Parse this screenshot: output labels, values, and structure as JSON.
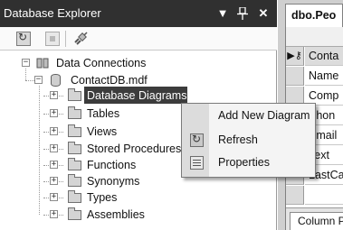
{
  "explorer": {
    "title": "Database Explorer",
    "dropdown_glyph": "▼",
    "pin_glyph": "⨃",
    "close_glyph": "✕"
  },
  "tree": {
    "root": "Data Connections",
    "database": "ContactDB.mdf",
    "children": [
      "Database Diagrams",
      "Tables",
      "Views",
      "Stored Procedures",
      "Functions",
      "Synonyms",
      "Types",
      "Assemblies"
    ],
    "selected": "Database Diagrams"
  },
  "context_menu": {
    "items": [
      "Add New Diagram",
      "Refresh",
      "Properties"
    ]
  },
  "document": {
    "tab_label": "dbo.Peo",
    "rows": [
      "Conta",
      "Name",
      "Comp",
      "Phon",
      "Email",
      "Text",
      "LastCa"
    ],
    "row_marker": "▶⚷",
    "bottom_tab": "Column P"
  },
  "icons": [
    "refresh-icon",
    "stop-icon",
    "connect-icon",
    "folder-icon",
    "database-icon",
    "properties-icon"
  ]
}
